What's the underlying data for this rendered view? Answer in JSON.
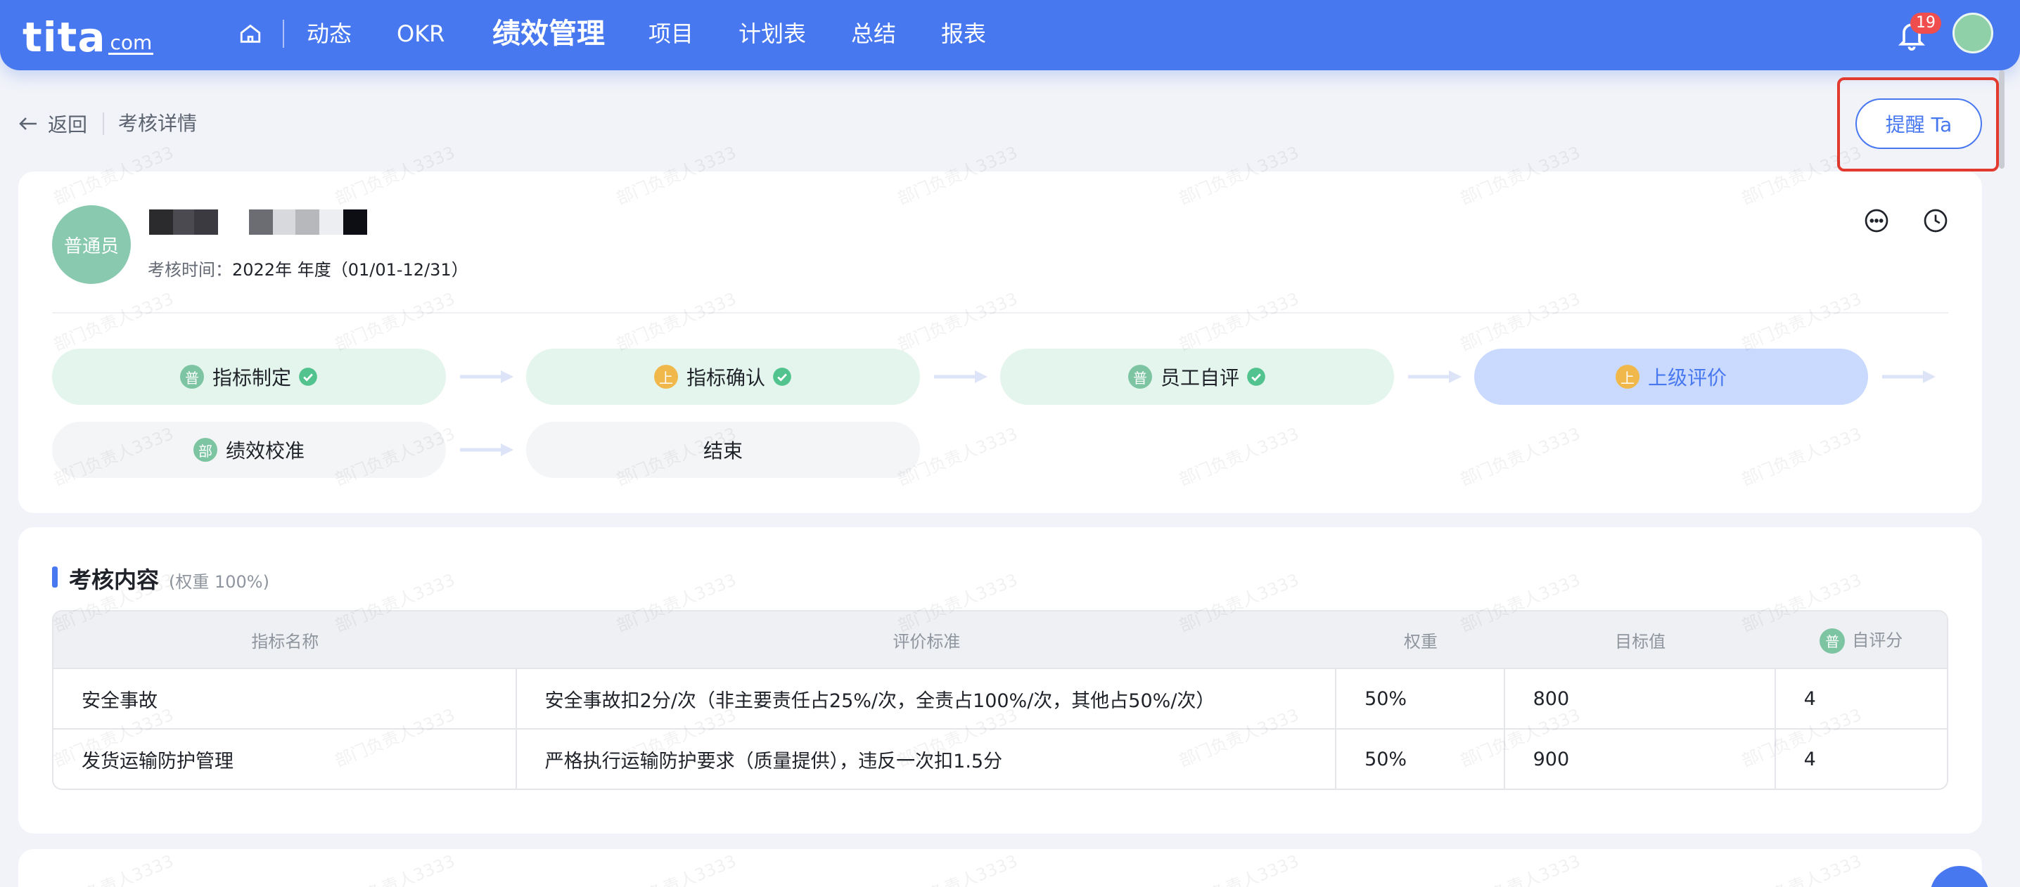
{
  "nav": {
    "logo_main": "tita",
    "logo_sub": "com",
    "items": [
      "动态",
      "OKR",
      "绩效管理",
      "项目",
      "计划表",
      "总结",
      "报表"
    ],
    "active_index": 2,
    "notification_count": "19"
  },
  "breadcrumb": {
    "back_label": "返回",
    "title": "考核详情"
  },
  "remind_button": "提醒 Ta",
  "employee": {
    "avatar_label": "普通员",
    "period_label": "考核时间：",
    "period_value": "2022年 年度（01/01-12/31）"
  },
  "steps": [
    {
      "badge": "普",
      "label": "指标制定",
      "status": "done"
    },
    {
      "badge": "上",
      "label": "指标确认",
      "status": "done"
    },
    {
      "badge": "普",
      "label": "员工自评",
      "status": "done"
    },
    {
      "badge": "上",
      "label": "上级评价",
      "status": "current"
    },
    {
      "badge": "部",
      "label": "绩效校准",
      "status": "pending"
    },
    {
      "badge": "",
      "label": "结束",
      "status": "pending"
    }
  ],
  "assessment": {
    "title": "考核内容",
    "weight_note": "(权重 100%)",
    "columns": [
      "指标名称",
      "评价标准",
      "权重",
      "目标值",
      "自评分"
    ],
    "self_score_badge": "普",
    "rows": [
      [
        "安全事故",
        "安全事故扣2分/次（非主要责任占25%/次，全责占100%/次，其他占50%/次）",
        "50%",
        "800",
        "4"
      ],
      [
        "发货运输防护管理",
        "严格执行运输防护要求（质量提供），违反一次扣1.5分",
        "50%",
        "900",
        "4"
      ]
    ]
  },
  "watermark": "部门负责人3333",
  "colors": {
    "brand": "#4878f0",
    "done_step": "#e3f5ec",
    "current_step": "#c9dafe",
    "highlight_frame": "#e23a2f",
    "badge_red": "#f04e4e"
  }
}
